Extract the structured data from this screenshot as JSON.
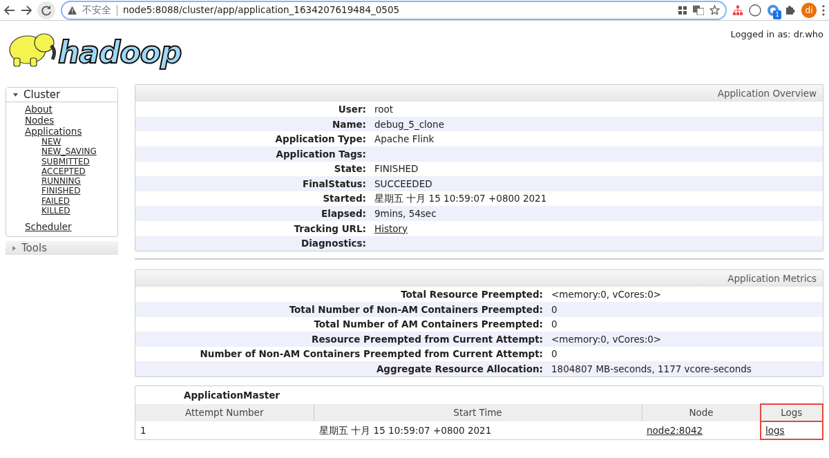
{
  "browser": {
    "security_label": "不安全",
    "url": "node5:8088/cluster/app/application_1634207619484_0505",
    "profile_initials": "di",
    "extension_badge": "1"
  },
  "header": {
    "logo_text": "hadoop",
    "logged_in": "Logged in as: dr.who"
  },
  "sidebar": [
    {
      "label": "Cluster",
      "expanded": true,
      "items": [
        {
          "label": "About"
        },
        {
          "label": "Nodes"
        },
        {
          "label": "Applications",
          "children": [
            {
              "label": "NEW"
            },
            {
              "label": "NEW_SAVING"
            },
            {
              "label": "SUBMITTED"
            },
            {
              "label": "ACCEPTED"
            },
            {
              "label": "RUNNING"
            },
            {
              "label": "FINISHED"
            },
            {
              "label": "FAILED"
            },
            {
              "label": "KILLED"
            }
          ]
        },
        {
          "label": "Scheduler"
        }
      ]
    },
    {
      "label": "Tools",
      "expanded": false
    }
  ],
  "overview": {
    "title": "Application Overview",
    "rows": [
      {
        "label": "User:",
        "value": "root"
      },
      {
        "label": "Name:",
        "value": "debug_5_clone"
      },
      {
        "label": "Application Type:",
        "value": "Apache Flink"
      },
      {
        "label": "Application Tags:",
        "value": ""
      },
      {
        "label": "State:",
        "value": "FINISHED"
      },
      {
        "label": "FinalStatus:",
        "value": "SUCCEEDED"
      },
      {
        "label": "Started:",
        "value": "星期五 十月 15 10:59:07 +0800 2021"
      },
      {
        "label": "Elapsed:",
        "value": "9mins, 54sec"
      },
      {
        "label": "Tracking URL:",
        "value": "History",
        "kind": "link"
      },
      {
        "label": "Diagnostics:",
        "value": ""
      }
    ]
  },
  "metrics": {
    "title": "Application Metrics",
    "rows": [
      {
        "label": "Total Resource Preempted:",
        "value": "<memory:0, vCores:0>"
      },
      {
        "label": "Total Number of Non-AM Containers Preempted:",
        "value": "0"
      },
      {
        "label": "Total Number of AM Containers Preempted:",
        "value": "0"
      },
      {
        "label": "Resource Preempted from Current Attempt:",
        "value": "<memory:0, vCores:0>"
      },
      {
        "label": "Number of Non-AM Containers Preempted from Current Attempt:",
        "value": "0"
      },
      {
        "label": "Aggregate Resource Allocation:",
        "value": "1804807 MB-seconds, 1177 vcore-seconds"
      }
    ]
  },
  "attempts": {
    "title": "ApplicationMaster",
    "columns": [
      {
        "label": "Attempt Number",
        "highlighted": false
      },
      {
        "label": "Start Time",
        "highlighted": false
      },
      {
        "label": "Node",
        "highlighted": false
      },
      {
        "label": "Logs",
        "highlighted": true
      }
    ],
    "rows": [
      [
        {
          "text": "1",
          "kind": "text"
        },
        {
          "text": "星期五 十月 15 10:59:07 +0800 2021",
          "kind": "text"
        },
        {
          "text": "node2:8042",
          "kind": "link"
        },
        {
          "text": "logs",
          "kind": "link"
        }
      ]
    ]
  }
}
